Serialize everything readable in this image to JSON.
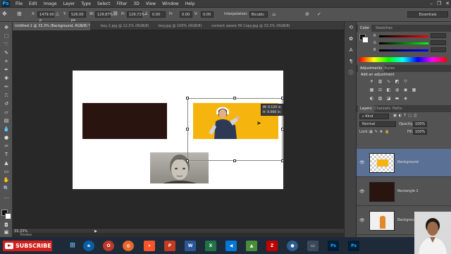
{
  "app": {
    "logo": "Ps"
  },
  "menu": [
    "File",
    "Edit",
    "Image",
    "Layer",
    "Type",
    "Select",
    "Filter",
    "3D",
    "View",
    "Window",
    "Help"
  ],
  "window_controls": [
    "–",
    "❐",
    "✕"
  ],
  "options": {
    "x_label": "X:",
    "x_value": "1479.00 p",
    "y_label": "Y:",
    "y_value": "526.00 px",
    "w_label": "W:",
    "w_value": "129.87%",
    "h_label": "H:",
    "h_value": "129.71%",
    "angle_value": "0.00",
    "h_skew_label": "H:",
    "h_skew_value": "0.00",
    "v_skew_label": "V:",
    "v_skew_value": "0.00",
    "interp_label": "Interpolation:",
    "interp_value": "Bicubic",
    "workspace": "Essentials"
  },
  "doc_tabs": [
    "Untitled-1 @ 33.3% (Background, RGB/8) *",
    "boy 2.jpg @ 12.5% (RGB/8)",
    "boy.jpg @ 100% (RGB/8)",
    "content aware fill Copy.jpg @ 33.3% (RGB/8)"
  ],
  "transform_tip": {
    "w": "W: 0.120 in",
    "h": "H: 0.000 in"
  },
  "status": {
    "zoom": "33.33%",
    "timeline": "Timeline"
  },
  "color_panel": {
    "tabs": [
      "Color",
      "Swatches"
    ],
    "r_label": "R",
    "r_value": "",
    "g_label": "G",
    "g_value": "",
    "b_label": "B",
    "b_value": ""
  },
  "adjustments_panel": {
    "tabs": [
      "Adjustments",
      "Styles"
    ],
    "heading": "Add an adjustment"
  },
  "layers_panel": {
    "tabs": [
      "Layers",
      "Channels",
      "Paths"
    ],
    "kind_label": "Kind",
    "blend_mode": "Normal",
    "opacity_label": "Opacity:",
    "opacity_value": "100%",
    "lock_label": "Lock:",
    "fill_label": "Fill:",
    "fill_value": "100%",
    "layers": [
      {
        "name": "Background"
      },
      {
        "name": "Rectangle 2"
      },
      {
        "name": "Background"
      }
    ]
  },
  "taskbar": {
    "subscribe_label": "SUBSCRIBE",
    "icons": [
      "W",
      "X",
      "Ps",
      "Ps"
    ]
  },
  "colors": {
    "rect2": "#2a1410",
    "yellow_banner": "#f5b50e",
    "layer_selected": "#5a7195",
    "subscribe": "#d1201b"
  }
}
